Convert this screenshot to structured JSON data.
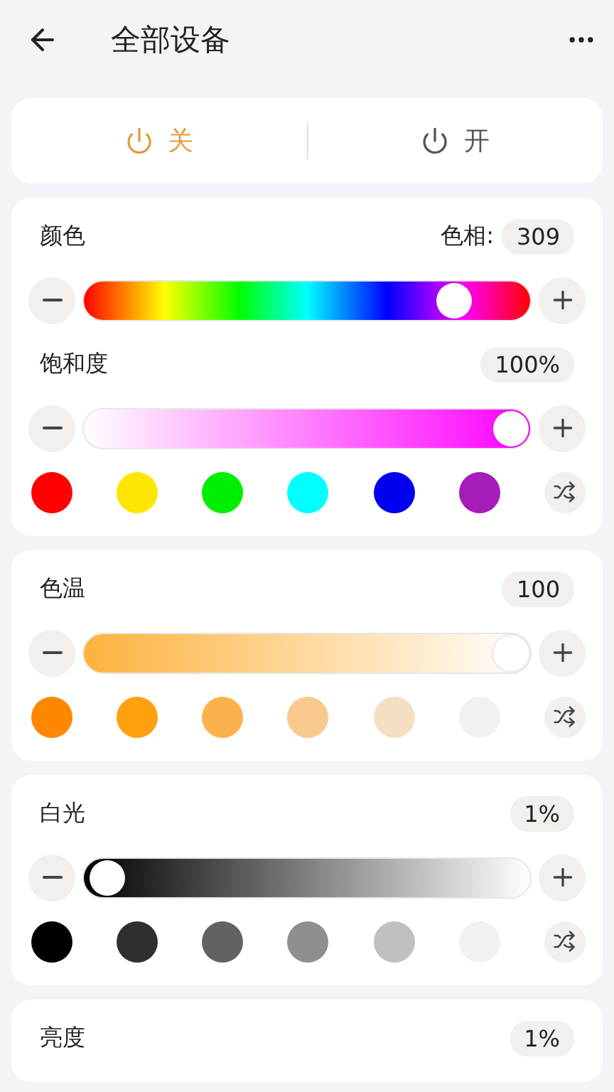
{
  "header": {
    "title": "全部设备"
  },
  "power": [
    {
      "label": "关",
      "selected": true
    },
    {
      "label": "开",
      "selected": false
    }
  ],
  "sections": [
    {
      "rows": [
        {
          "kind": "header",
          "title": "颜色",
          "value_label": "色相:",
          "value": "309"
        },
        {
          "kind": "hue",
          "level": 0.86
        },
        {
          "kind": "header",
          "title": "饱和度",
          "value": "100%"
        },
        {
          "kind": "saturation",
          "level": 1
        },
        {
          "kind": "swatches",
          "swatches": [
            {
              "color": "#ff0000"
            },
            {
              "color": "#ffe600"
            },
            {
              "color": "#00ee00"
            },
            {
              "color": "#00ffff"
            },
            {
              "color": "#0000ee"
            },
            {
              "color": "#a51cb8"
            }
          ]
        }
      ]
    },
    {
      "rows": [
        {
          "kind": "header",
          "title": "色温",
          "value": "100"
        },
        {
          "kind": "temperature",
          "level": 1
        },
        {
          "kind": "swatches",
          "swatches": [
            {
              "color": "#ff8800"
            },
            {
              "color": "#ffa00e"
            },
            {
              "color": "#fbb24c"
            },
            {
              "color": "#f9c98d"
            },
            {
              "color": "#f4dfc2"
            },
            {
              "color": "#f1f1f1"
            }
          ]
        }
      ]
    },
    {
      "rows": [
        {
          "kind": "header",
          "title": "白光",
          "value": "1%"
        },
        {
          "kind": "white",
          "level": 0.01
        },
        {
          "kind": "swatches",
          "swatches": [
            {
              "color": "#000000"
            },
            {
              "color": "#2f2f2f"
            },
            {
              "color": "#626262"
            },
            {
              "color": "#8f8f8f"
            },
            {
              "color": "#c0c0c0"
            },
            {
              "color": "#f1f1f1"
            }
          ]
        }
      ]
    },
    {
      "rows": [
        {
          "kind": "header",
          "title": "亮度",
          "value": "1%"
        }
      ]
    }
  ]
}
